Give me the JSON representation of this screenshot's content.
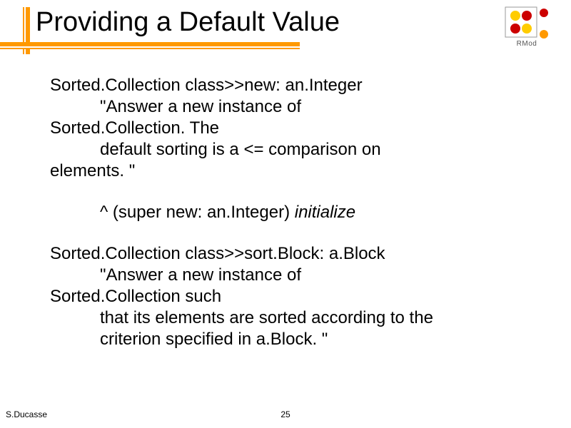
{
  "title": "Providing a Default Value",
  "logo_label": "RMod",
  "body": {
    "p1_l1": "Sorted.Collection class>>new: an.Integer",
    "p1_l2": "\"Answer a new instance of",
    "p1_l3": "Sorted.Collection. The",
    "p1_l4": "default sorting is a <= comparison on",
    "p1_l5": "elements. \"",
    "p2_pre": "^ (super new: an.Integer) ",
    "p2_ital": "initialize",
    "p3_l1": "Sorted.Collection class>>sort.Block: a.Block",
    "p3_l2": "\"Answer a new instance of",
    "p3_l3": "Sorted.Collection such",
    "p3_l4": "that its elements are sorted according to the",
    "p3_l5": "criterion specified in a.Block. \""
  },
  "footer": {
    "author": "S.Ducasse",
    "page": "25"
  }
}
